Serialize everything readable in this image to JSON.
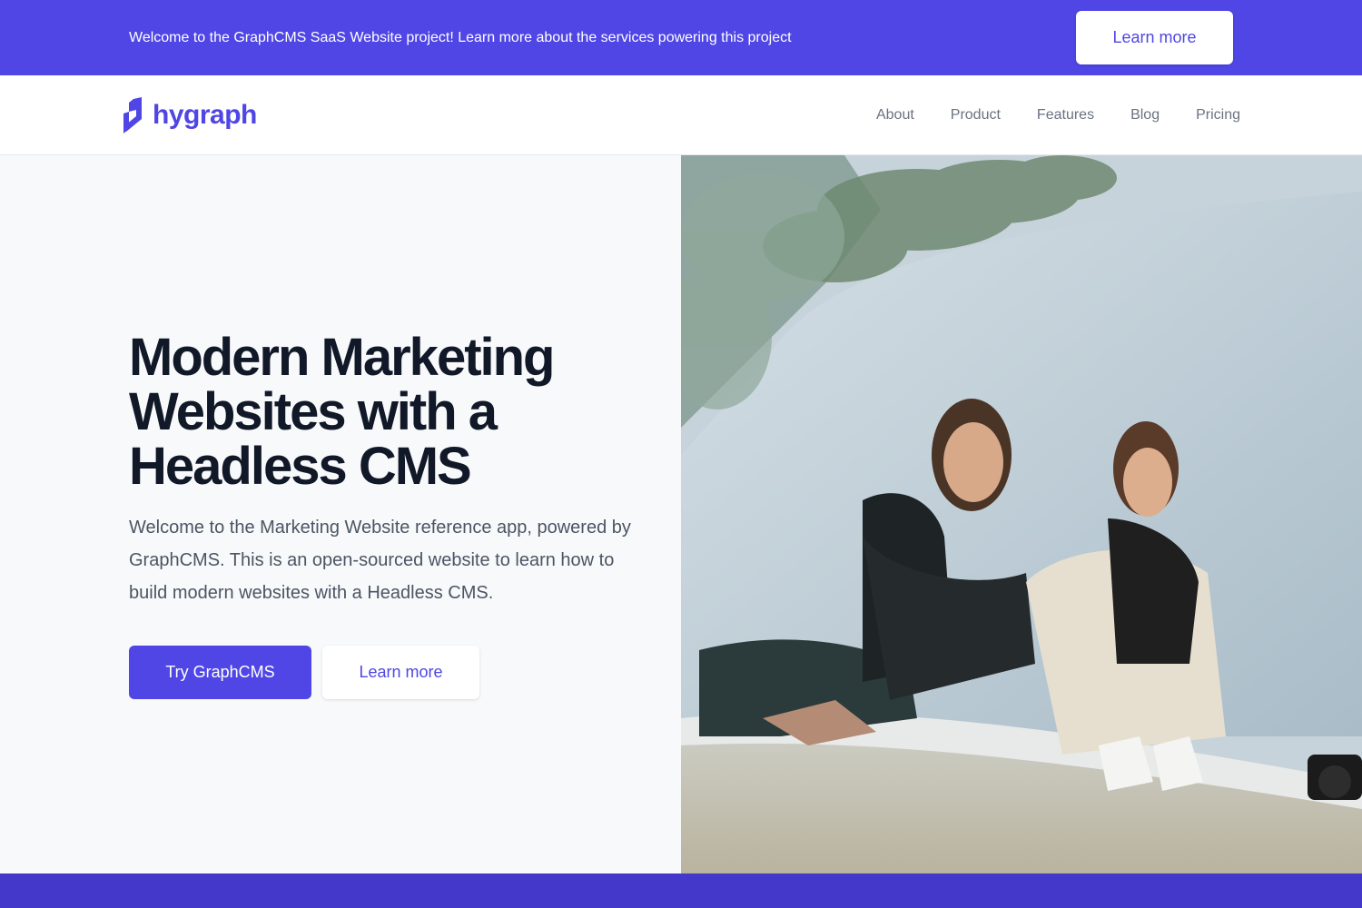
{
  "banner": {
    "text": "Welcome to the GraphCMS SaaS Website project! Learn more about the services powering this project",
    "button_label": "Learn more"
  },
  "navbar": {
    "logo_text": "hygraph",
    "links": [
      {
        "label": "About"
      },
      {
        "label": "Product"
      },
      {
        "label": "Features"
      },
      {
        "label": "Blog"
      },
      {
        "label": "Pricing"
      }
    ]
  },
  "hero": {
    "title": "Modern Marketing Websites with a Headless CMS",
    "description": "Welcome to the Marketing Website reference app, powered by GraphCMS. This is an open-sourced website to learn how to build modern websites with a Headless CMS.",
    "primary_button": "Try GraphCMS",
    "secondary_button": "Learn more"
  },
  "colors": {
    "brand": "#4f46e5",
    "brand_dark": "#4338ca",
    "heading": "#111827",
    "body_text": "#4b5563",
    "nav_text": "#6b7280"
  },
  "icons": {
    "logo": "hygraph-logo-mark-icon"
  }
}
